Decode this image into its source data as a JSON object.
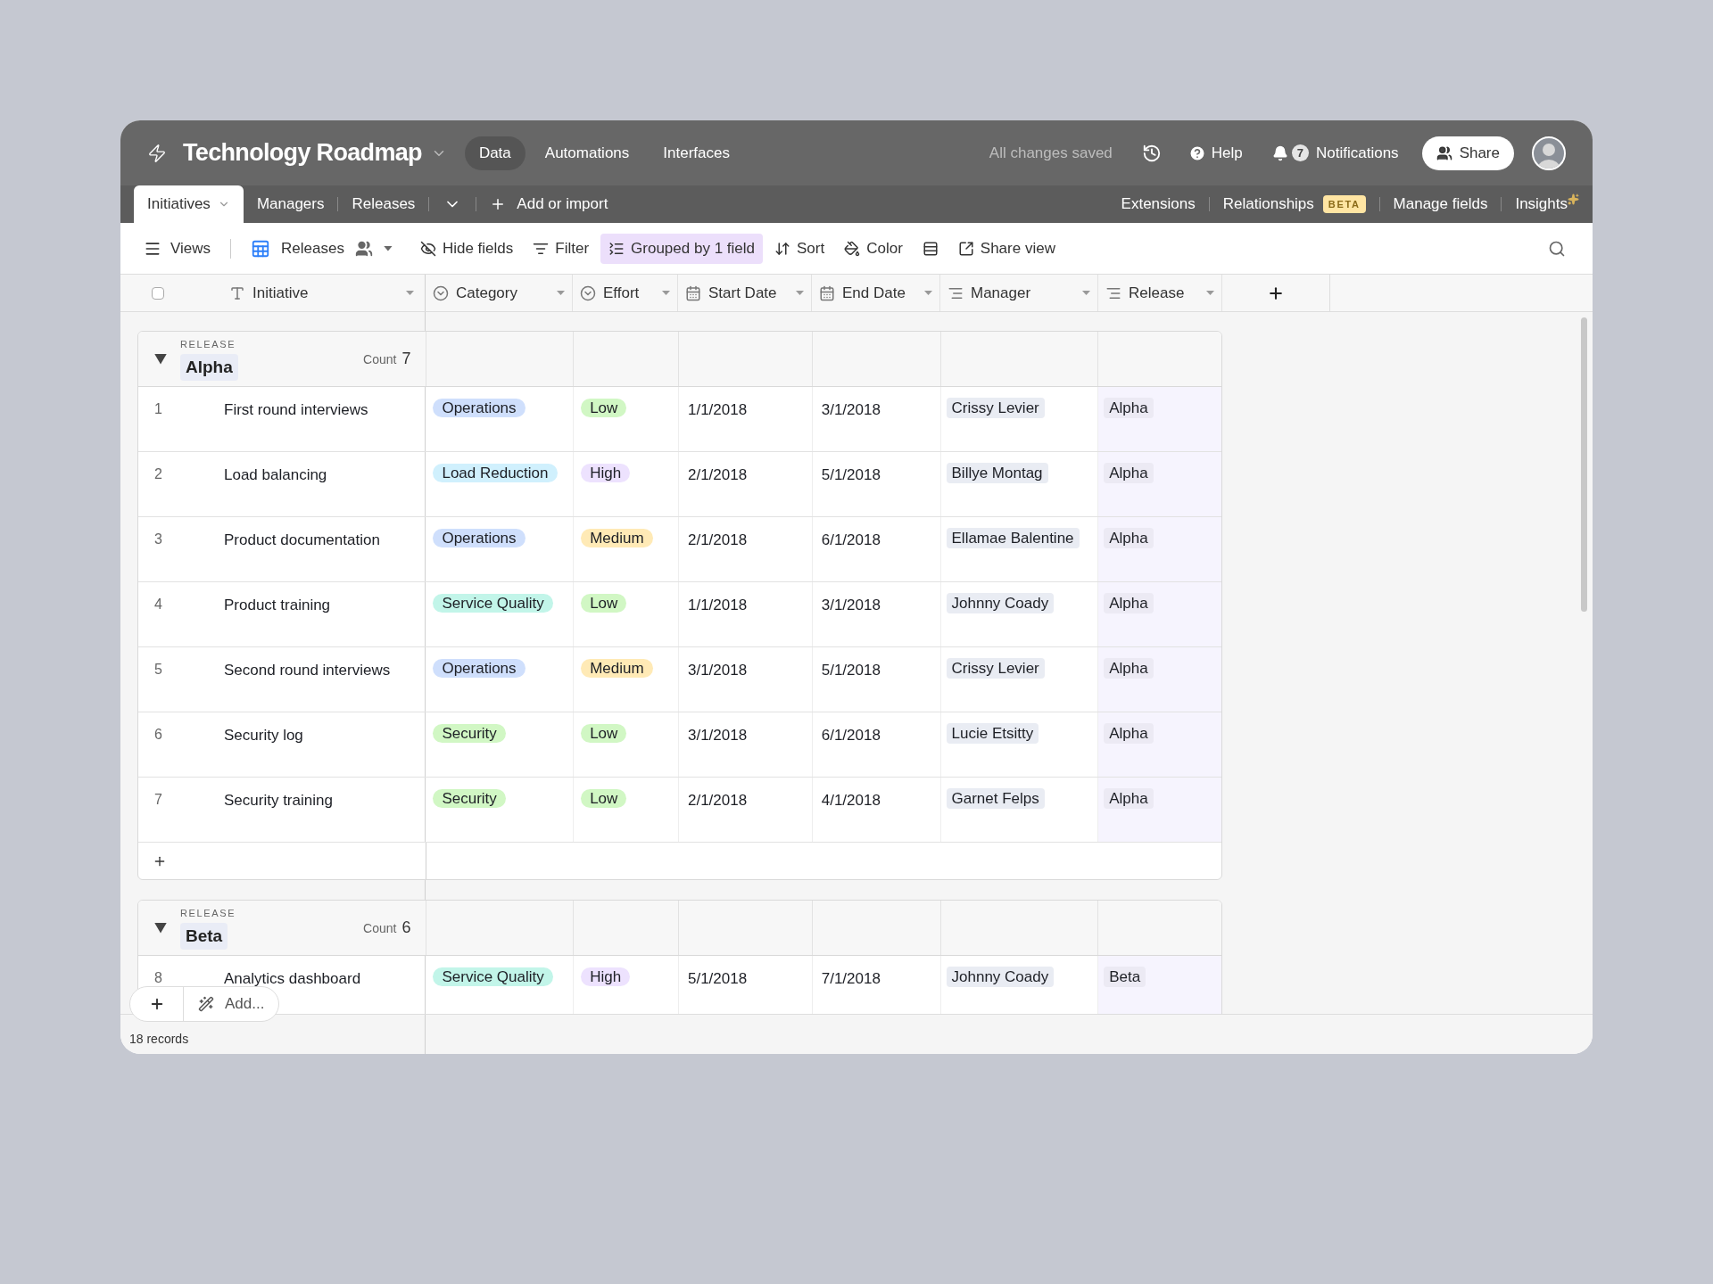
{
  "app": {
    "title": "Technology Roadmap"
  },
  "top_nav": [
    {
      "label": "Data",
      "selected": true
    },
    {
      "label": "Automations",
      "selected": false
    },
    {
      "label": "Interfaces",
      "selected": false
    }
  ],
  "save_status": "All changes saved",
  "help": "Help",
  "notifications": {
    "count": "7",
    "label": "Notifications"
  },
  "share": "Share",
  "tables": [
    {
      "label": "Initiatives",
      "selected": true
    },
    {
      "label": "Managers",
      "selected": false
    },
    {
      "label": "Releases",
      "selected": false
    }
  ],
  "add_import": "Add or import",
  "table_actions": [
    {
      "label": "Extensions"
    },
    {
      "label": "Relationships",
      "badge": "BETA"
    },
    {
      "label": "Manage fields"
    },
    {
      "label": "Insights",
      "sparkle": true
    }
  ],
  "toolbar": {
    "views": "Views",
    "view_name": "Releases",
    "items": [
      {
        "kind": "hide",
        "label": "Hide fields",
        "selected": false
      },
      {
        "kind": "filter",
        "label": "Filter",
        "selected": false
      },
      {
        "kind": "group",
        "label": "Grouped by 1 field",
        "selected": true
      },
      {
        "kind": "sort",
        "label": "Sort",
        "selected": false
      },
      {
        "kind": "color",
        "label": "Color",
        "selected": false
      },
      {
        "kind": "row_height",
        "selected": false
      },
      {
        "kind": "share",
        "label": "Share view",
        "selected": false
      }
    ]
  },
  "select_all": {
    "checked": false
  },
  "columns": [
    {
      "label": "Initiative",
      "kind": "text"
    },
    {
      "label": "Category",
      "kind": "select"
    },
    {
      "label": "Effort",
      "kind": "select"
    },
    {
      "label": "Start Date",
      "kind": "date"
    },
    {
      "label": "End Date",
      "kind": "date"
    },
    {
      "label": "Manager",
      "kind": "link"
    },
    {
      "label": "Release",
      "kind": "link"
    }
  ],
  "groups": [
    {
      "field": "RELEASE",
      "name": "Alpha",
      "count_label": "Count",
      "count": "7",
      "expanded": true,
      "rows": [
        {
          "number": "1",
          "initiative": "First round interviews",
          "category": {
            "label": "Operations",
            "color": "#cfdffc"
          },
          "effort": {
            "label": "Low",
            "color": "#d1f7c4"
          },
          "start": "1/1/2018",
          "end": "3/1/2018",
          "manager": "Crissy Levier",
          "release": "Alpha"
        },
        {
          "number": "2",
          "initiative": "Load balancing",
          "category": {
            "label": "Load Reduction",
            "color": "#d0f0fd"
          },
          "effort": {
            "label": "High",
            "color": "#ede2fe"
          },
          "start": "2/1/2018",
          "end": "5/1/2018",
          "manager": "Billye Montag",
          "release": "Alpha"
        },
        {
          "number": "3",
          "initiative": "Product documentation",
          "category": {
            "label": "Operations",
            "color": "#cfdffc"
          },
          "effort": {
            "label": "Medium",
            "color": "#ffeab6"
          },
          "start": "2/1/2018",
          "end": "6/1/2018",
          "manager": "Ellamae Balentine",
          "release": "Alpha"
        },
        {
          "number": "4",
          "initiative": "Product training",
          "category": {
            "label": "Service Quality",
            "color": "#c2f5e9"
          },
          "effort": {
            "label": "Low",
            "color": "#d1f7c4"
          },
          "start": "1/1/2018",
          "end": "3/1/2018",
          "manager": "Johnny Coady",
          "release": "Alpha"
        },
        {
          "number": "5",
          "initiative": "Second round interviews",
          "category": {
            "label": "Operations",
            "color": "#cfdffc"
          },
          "effort": {
            "label": "Medium",
            "color": "#ffeab6"
          },
          "start": "3/1/2018",
          "end": "5/1/2018",
          "manager": "Crissy Levier",
          "release": "Alpha"
        },
        {
          "number": "6",
          "initiative": "Security log",
          "category": {
            "label": "Security",
            "color": "#d1f7c4"
          },
          "effort": {
            "label": "Low",
            "color": "#d1f7c4"
          },
          "start": "3/1/2018",
          "end": "6/1/2018",
          "manager": "Lucie Etsitty",
          "release": "Alpha"
        },
        {
          "number": "7",
          "initiative": "Security training",
          "category": {
            "label": "Security",
            "color": "#d1f7c4"
          },
          "effort": {
            "label": "Low",
            "color": "#d1f7c4"
          },
          "start": "2/1/2018",
          "end": "4/1/2018",
          "manager": "Garnet Felps",
          "release": "Alpha"
        }
      ]
    },
    {
      "field": "RELEASE",
      "name": "Beta",
      "count_label": "Count",
      "count": "6",
      "expanded": true,
      "rows": [
        {
          "number": "8",
          "initiative": "Analytics dashboard",
          "category": {
            "label": "Service Quality",
            "color": "#c2f5e9"
          },
          "effort": {
            "label": "High",
            "color": "#ede2fe"
          },
          "start": "5/1/2018",
          "end": "7/1/2018",
          "manager": "Johnny Coady",
          "release": "Beta"
        }
      ]
    }
  ],
  "add_menu": "Add...",
  "record_count": "18 records"
}
